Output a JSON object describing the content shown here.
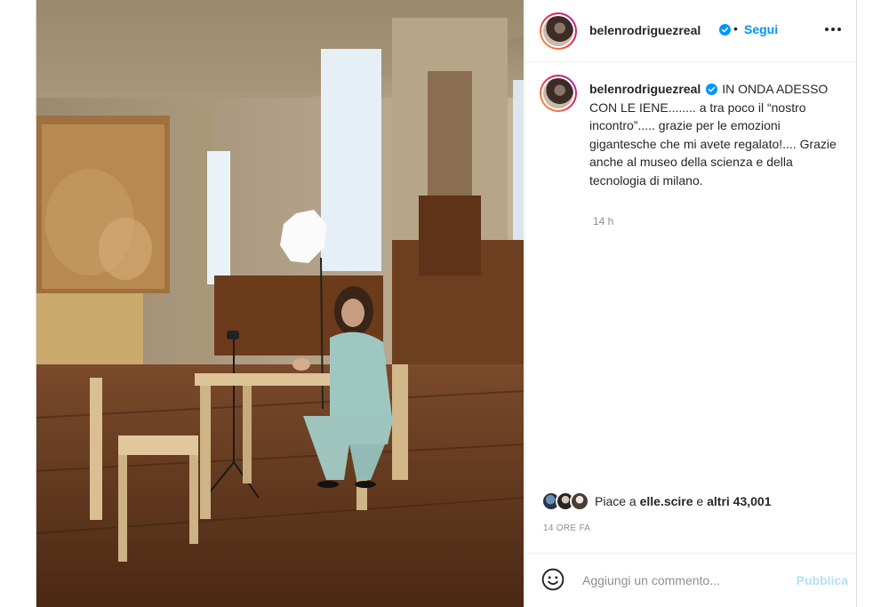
{
  "post": {
    "username": "belenrodriguezreal",
    "follow_label": "Segui",
    "separator": "•",
    "caption_username": "belenrodriguezreal",
    "caption_text": "IN ONDA ADESSO CON LE IENE........ a tra poco il “nostro incontro”..... grazie per le emozioni gigantesche che mi avete regalato!.... Grazie anche al museo della scienza e della tecnologia di milano.",
    "caption_time": "14 h",
    "likes_prefix": "Piace a",
    "likes_user": "elle.scire",
    "likes_connector": "e",
    "likes_others": "altri 43,001",
    "date_label": "14 ORE FA"
  },
  "comment": {
    "placeholder": "Aggiungi un commento...",
    "publish_label": "Pubblica"
  },
  "icons": {
    "verified": "verified-badge-icon",
    "more": "more-options-icon",
    "emoji": "emoji-icon"
  },
  "colors": {
    "accent": "#0095f6",
    "publish_disabled": "#b2dffc",
    "secondary_text": "#8e8e8e"
  }
}
